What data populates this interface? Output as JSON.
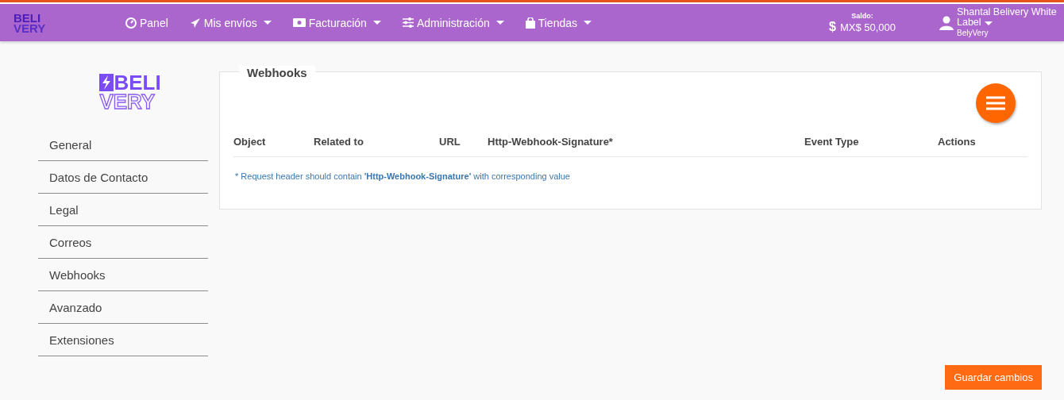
{
  "header": {
    "logo": [
      "BELI",
      "VERY"
    ],
    "nav": [
      {
        "label": "Panel",
        "dropdown": false
      },
      {
        "label": "Mis envíos",
        "dropdown": true
      },
      {
        "label": "Facturación",
        "dropdown": true
      },
      {
        "label": "Administración",
        "dropdown": true
      },
      {
        "label": "Tiendas",
        "dropdown": true
      }
    ],
    "balance": {
      "label": "Saldo:",
      "currency_symbol": "$",
      "amount": "MX$ 50,000"
    },
    "user": {
      "name": "Shantal Belivery White",
      "name_line2": "Label",
      "company": "BelyVery"
    }
  },
  "sidebar": {
    "logo": [
      "BELI",
      "VERY"
    ],
    "items": [
      {
        "label": "General"
      },
      {
        "label": "Datos de Contacto"
      },
      {
        "label": "Legal"
      },
      {
        "label": "Correos"
      },
      {
        "label": "Webhooks"
      },
      {
        "label": "Avanzado"
      },
      {
        "label": "Extensiones"
      }
    ]
  },
  "panel": {
    "title": "Webhooks",
    "table": {
      "columns": [
        "Object",
        "Related to",
        "URL",
        "Http-Webhook-Signature*",
        "Event Type",
        "Actions"
      ]
    },
    "note": "* Request header should contain **'Http-Webhook-Signature'** with corresponding value"
  },
  "save_button": "Guardar cambios"
}
